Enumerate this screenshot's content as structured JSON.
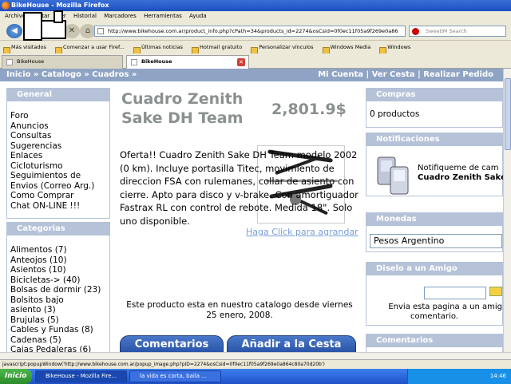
{
  "window": {
    "title": "BikeHouse - Mozilla Firefox"
  },
  "menu": [
    "Archivo",
    "Editar",
    "Ver",
    "Historial",
    "Marcadores",
    "Herramientas",
    "Ayuda"
  ],
  "url": "http://www.bikehouse.com.ar/product_info.php?cPath=34&products_id=2274&osCsid=0f0ec11f05a9f269e0a86",
  "search_placeholder": "SweetIM Search",
  "bookmarks": [
    "Más visitados",
    "Comenzar a usar Firef...",
    "Últimas noticias",
    "Hotmail gratuito",
    "Personalizar vínculos",
    "Windows Media",
    "Windows"
  ],
  "tabs": [
    {
      "label": "BikeHouse"
    },
    {
      "label": "BikeHouse"
    }
  ],
  "breadcrumb": {
    "left": "Inicio » Catalogo » Cuadros »",
    "right": "Mi Cuenta | Ver Cesta | Realizar Pedido"
  },
  "general": {
    "title": "General",
    "items": [
      "Foro",
      "Anuncios",
      "Consultas",
      "Sugerencias",
      "Enlaces",
      "Cicloturismo",
      "Seguimientos de",
      "Envios (Correo Arg.)",
      "Como Comprar",
      "Chat ON-LINE !!!"
    ]
  },
  "categorias": {
    "title": "Categorias",
    "items": [
      "Alimentos (7)",
      "Anteojos (10)",
      "Asientos (10)",
      "Bicicletas-> (40)",
      "Bolsas de dormir (23)",
      "Bolsitos bajo",
      "asiento (3)",
      "Brujulas (5)",
      "Cables y Fundas (8)",
      "Cadenas (5)",
      "Cajas Pedaleras (6)"
    ]
  },
  "product": {
    "title": "Cuadro Zenith Sake DH Team",
    "price": "2,801.9$",
    "description": "Oferta!! Cuadro Zenith Sake DH Team modelo 2002 (0 km). Incluye portasilla Titec, movimiento de direccion FSA con rulemanes, collar de asiento con cierre. Apto para disco y v-brake. Con amortiguador Fastrax RL con control de rebote. Medida 18\". Solo uno disponible.",
    "image_link": "Haga Click para agrandar",
    "catalog_note": "Este producto esta en nuestro catalogo desde viernes 25 enero, 2008.",
    "btn_comments": "Comentarios",
    "btn_cart": "Añadir a la Cesta"
  },
  "compras": {
    "title": "Compras",
    "text": "0 productos"
  },
  "notificaciones": {
    "title": "Notificaciones",
    "line1": "Notifiqueme de cam",
    "line2": "Cuadro Zenith Sake"
  },
  "monedas": {
    "title": "Monedas",
    "selected": "Pesos Argentino"
  },
  "amigo": {
    "title": "Diselo a un Amigo",
    "line1": "Envia esta pagina a un amig",
    "line2": "comentario."
  },
  "comentarios": {
    "title": "Comentarios"
  },
  "status": "javascript:popupWindow('http://www.bikehouse.com.ar/popup_image.php?pID=2274&osCsid=0f0ec11f05a9f269e0a864c80a70d20b')",
  "taskbar": {
    "start": "Inicio",
    "items": [
      "BikeHouse - Mozilla Fire...",
      "la vida es corta, baila ..."
    ],
    "clock": "14:46"
  }
}
